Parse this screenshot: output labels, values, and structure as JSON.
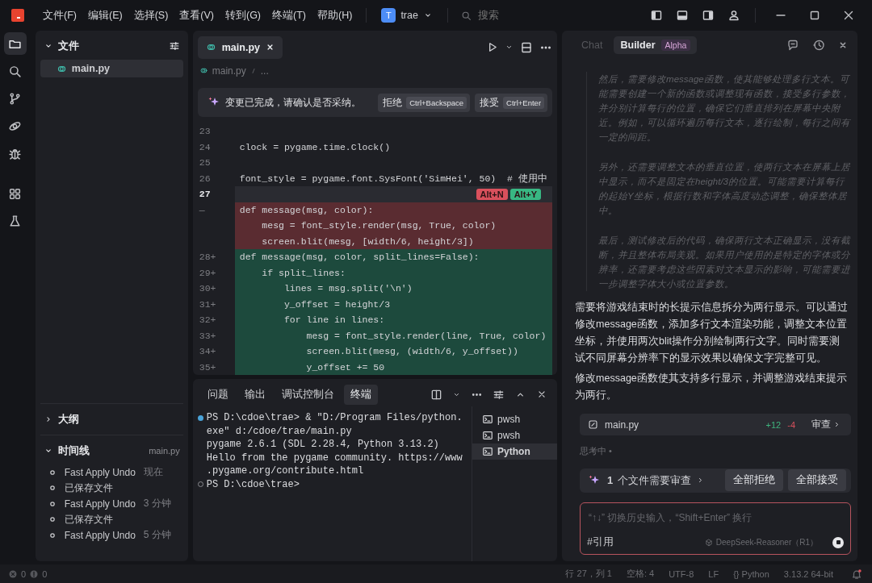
{
  "title_bar": {
    "menus": [
      "文件(F)",
      "编辑(E)",
      "选择(S)",
      "查看(V)",
      "转到(G)",
      "终端(T)",
      "帮助(H)"
    ],
    "project": {
      "initial": "T",
      "name": "trae"
    },
    "search": {
      "placeholder": "搜索"
    }
  },
  "activity_bar": [
    {
      "kind": "explorer",
      "selected": true
    },
    {
      "kind": "search",
      "selected": false
    },
    {
      "kind": "source-control",
      "selected": false
    },
    {
      "kind": "remote",
      "selected": false
    },
    {
      "kind": "debug",
      "selected": false
    },
    {
      "kind": "extensions",
      "selected": false
    },
    {
      "kind": "testing",
      "selected": false
    }
  ],
  "explorer": {
    "title": "文件",
    "files": [
      {
        "name": "main.py",
        "selected": true
      }
    ]
  },
  "outline": {
    "title": "大纲",
    "expanded": false
  },
  "timeline": {
    "title": "时间线",
    "file": "main.py",
    "expanded": true,
    "entries": [
      {
        "label": "Fast Apply Undo",
        "time": "现在"
      },
      {
        "label": "已保存文件"
      },
      {
        "label": "Fast Apply Undo",
        "time": "3 分钟"
      },
      {
        "label": "已保存文件"
      },
      {
        "label": "Fast Apply Undo",
        "time": "5 分钟"
      }
    ]
  },
  "editor": {
    "tabs": [
      {
        "label": "main.py",
        "selected": true
      }
    ],
    "breadcrumb": [
      "main.py",
      "..."
    ],
    "change_banner": {
      "message": "变更已完成，请确认是否采纳。",
      "reject": {
        "label": "拒绝",
        "shortcut": "Ctrl+Backspace"
      },
      "accept": {
        "label": "接受",
        "shortcut": "Ctrl+Enter"
      }
    },
    "lines": [
      {
        "number": "23",
        "kind": "normal"
      },
      {
        "number": "24",
        "kind": "normal",
        "text": "clock = pygame.time.Clock()"
      },
      {
        "number": "25",
        "kind": "normal"
      },
      {
        "number": "26",
        "kind": "normal",
        "text": "font_style = pygame.font.SysFont('SimHei', 50)  # 使用中"
      },
      {
        "number": "27",
        "kind": "normal",
        "current": true,
        "hunk_keys": {
          "reject": "Alt+N",
          "accept": "Alt+Y"
        }
      },
      {
        "number": "—",
        "kind": "removed",
        "text": "def message(msg, color):"
      },
      {
        "kind": "removed",
        "text": "    mesg = font_style.render(msg, True, color)"
      },
      {
        "kind": "removed",
        "text": "    screen.blit(mesg, [width/6, height/3])"
      },
      {
        "number": "28+",
        "kind": "added",
        "text": "def message(msg, color, split_lines=False):"
      },
      {
        "number": "29+",
        "kind": "added",
        "text": "    if split_lines:"
      },
      {
        "number": "30+",
        "kind": "added",
        "text": "        lines = msg.split('\\n')"
      },
      {
        "number": "31+",
        "kind": "added",
        "text": "        y_offset = height/3"
      },
      {
        "number": "32+",
        "kind": "added",
        "text": "        for line in lines:"
      },
      {
        "number": "33+",
        "kind": "added",
        "text": "            mesg = font_style.render(line, True, color)"
      },
      {
        "number": "34+",
        "kind": "added",
        "text": "            screen.blit(mesg, (width/6, y_offset))"
      },
      {
        "number": "35+",
        "kind": "added",
        "text": "            y_offset += 50"
      }
    ]
  },
  "panel": {
    "tabs": [
      {
        "label": "问题",
        "selected": false
      },
      {
        "label": "输出",
        "selected": false
      },
      {
        "label": "调试控制台",
        "selected": false
      },
      {
        "label": "终端",
        "selected": true
      }
    ],
    "terminal_lines": [
      {
        "text": "PS D:\\cdoe\\trae> & \"D:/Program Files/python.",
        "kind": "success"
      },
      {
        "text": "exe\" d:/cdoe/trae/main.py",
        "kind": "output"
      },
      {
        "text": "pygame 2.6.1 (SDL 2.28.4, Python 3.13.2)",
        "kind": "output"
      },
      {
        "text": "Hello from the pygame community. https://www",
        "kind": "output"
      },
      {
        "text": ".pygame.org/contribute.html",
        "kind": "output"
      },
      {
        "text": "PS D:\\cdoe\\trae>",
        "kind": "idle"
      }
    ],
    "terminals": [
      {
        "name": "pwsh",
        "selected": false
      },
      {
        "name": "pwsh",
        "selected": false
      },
      {
        "name": "Python",
        "selected": true
      }
    ]
  },
  "chat": {
    "tabs": [
      {
        "label": "Chat",
        "selected": false
      },
      {
        "label": "Builder",
        "badge": "Alpha",
        "selected": true
      }
    ],
    "thinking": [
      "然后，需要修改message函数，使其能够处理多行文本。可能需要创建一个新的函数或调整现有函数，接受多行参数，并分别计算每行的位置，确保它们垂直排列在屏幕中央附近。例如，可以循环遍历每行文本，逐行绘制，每行之间有一定的间距。",
      "另外，还需要调整文本的垂直位置，使两行文本在屏幕上居中显示，而不是固定在height/3的位置。可能需要计算每行的起始Y坐标，根据行数和字体高度动态调整，确保整体居中。",
      "最后，测试修改后的代码，确保两行文本正确显示，没有截断，并且整体布局美观。如果用户使用的是特定的字体或分辨率，还需要考虑这些因素对文本显示的影响，可能需要进一步调整字体大小或位置参数。"
    ],
    "answer": [
      "需要将游戏结束时的长提示信息拆分为两行显示。可以通过修改message函数，添加多行文本渲染功能，调整文本位置坐标，并使用两次blit操作分别绘制两行文字。同时需要测试不同屏幕分辨率下的显示效果以确保文字完整可见。",
      "修改message函数使其支持多行显示，并调整游戏结束提示为两行。"
    ],
    "file_change": {
      "name": "main.py",
      "added": "+12",
      "removed": "-4",
      "action": "审查"
    },
    "status": "思考中 •",
    "review": {
      "count": "1",
      "text": "个文件需要审查",
      "reject_all": "全部拒绝",
      "accept_all": "全部接受"
    },
    "input": {
      "placeholder": "“↑↓” 切换历史输入，“Shift+Enter” 换行",
      "reference": "#引用",
      "model": "DeepSeek-Reasoner（R1）"
    }
  },
  "status_bar": {
    "errors": "0",
    "warnings": "0",
    "items": [
      "行 27，列 1",
      "空格: 4",
      "UTF-8",
      "LF",
      "{} Python",
      "3.13.2 64-bit"
    ]
  }
}
